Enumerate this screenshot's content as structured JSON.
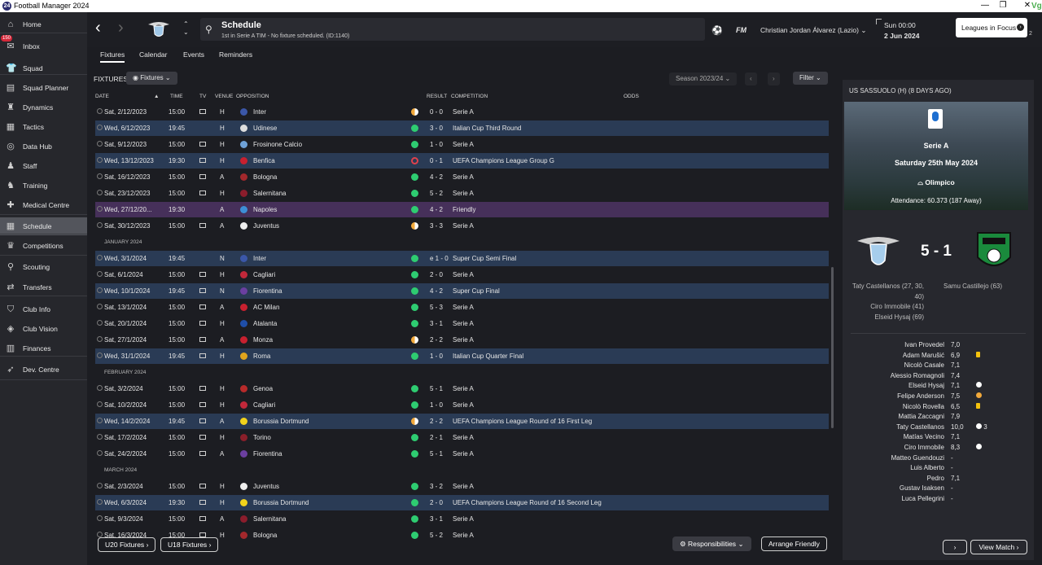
{
  "window": {
    "title": "Football Manager 2024",
    "app_icon": "24",
    "controls": [
      "—",
      "❐",
      "✕"
    ]
  },
  "sidebar": {
    "items": [
      {
        "label": "Home",
        "icon": "home-icon"
      },
      {
        "label": "Inbox",
        "icon": "inbox-icon",
        "badge": "150"
      },
      {
        "label": "Squad",
        "icon": "shirt-icon"
      },
      {
        "label": "Squad Planner",
        "icon": "planner-icon"
      },
      {
        "label": "Dynamics",
        "icon": "dynamics-icon"
      },
      {
        "label": "Tactics",
        "icon": "tactics-icon"
      },
      {
        "label": "Data Hub",
        "icon": "data-hub-icon"
      },
      {
        "label": "Staff",
        "icon": "staff-icon"
      },
      {
        "label": "Training",
        "icon": "training-icon"
      },
      {
        "label": "Medical Centre",
        "icon": "medical-icon"
      },
      {
        "label": "Schedule",
        "icon": "calendar-icon"
      },
      {
        "label": "Competitions",
        "icon": "trophy-icon"
      },
      {
        "label": "Scouting",
        "icon": "scouting-icon"
      },
      {
        "label": "Transfers",
        "icon": "transfers-icon"
      },
      {
        "label": "Club Info",
        "icon": "shield-icon"
      },
      {
        "label": "Club Vision",
        "icon": "vision-icon"
      },
      {
        "label": "Finances",
        "icon": "finances-icon"
      },
      {
        "label": "Dev. Centre",
        "icon": "dev-centre-icon"
      }
    ]
  },
  "topbar": {
    "title": "Schedule",
    "subtitle": "1st in Serie A TIM - No fixture scheduled. (ID:1140)",
    "fm_logo": "FM",
    "manager": "Christian Jordan Álvarez (Lazio)",
    "day_time": "Sun 00:00",
    "date": "2 Jun 2024",
    "focus_button": "Leagues in Focus",
    "focus_count": "2"
  },
  "tabs": [
    "Fixtures",
    "Calendar",
    "Events",
    "Reminders"
  ],
  "fixtures": {
    "header": "FIXTURES",
    "view_dropdown": "Fixtures",
    "season": "Season 2023/24",
    "filter": "Filter",
    "columns": {
      "date": "DATE",
      "time": "TIME",
      "tv": "TV",
      "venue": "VENUE",
      "opposition": "OPPOSITION",
      "result": "RESULT",
      "competition": "COMPETITION",
      "odds": "ODDS"
    },
    "rows": [
      {
        "date": "Sat, 2/12/2023",
        "time": "15:00",
        "tv": true,
        "venue": "H",
        "opp": "Inter",
        "result": "0 - 0",
        "comp": "Serie A",
        "outcome": "draw",
        "kind": "league",
        "crest": "#3b57a8"
      },
      {
        "date": "Wed, 6/12/2023",
        "time": "19:45",
        "tv": false,
        "venue": "H",
        "opp": "Udinese",
        "result": "3 - 0",
        "comp": "Italian Cup Third Round",
        "outcome": "win",
        "kind": "cup",
        "crest": "#dddddd"
      },
      {
        "date": "Sat, 9/12/2023",
        "time": "15:00",
        "tv": true,
        "venue": "H",
        "opp": "Frosinone Calcio",
        "result": "1 - 0",
        "comp": "Serie A",
        "outcome": "win",
        "kind": "league",
        "crest": "#6fa2d8"
      },
      {
        "date": "Wed, 13/12/2023",
        "time": "19:30",
        "tv": true,
        "venue": "H",
        "opp": "Benfica",
        "result": "0 - 1",
        "comp": "UEFA Champions League Group G",
        "outcome": "loss",
        "kind": "cup",
        "crest": "#c8202f"
      },
      {
        "date": "Sat, 16/12/2023",
        "time": "15:00",
        "tv": true,
        "venue": "A",
        "opp": "Bologna",
        "result": "4 - 2",
        "comp": "Serie A",
        "outcome": "win",
        "kind": "league",
        "crest": "#a3282c"
      },
      {
        "date": "Sat, 23/12/2023",
        "time": "15:00",
        "tv": true,
        "venue": "H",
        "opp": "Salernitana",
        "result": "5 - 2",
        "comp": "Serie A",
        "outcome": "win",
        "kind": "league",
        "crest": "#8b1d2c"
      },
      {
        "date": "Wed, 27/12/20...",
        "time": "19:30",
        "tv": false,
        "venue": "A",
        "opp": "Napoles",
        "result": "4 - 2",
        "comp": "Friendly",
        "outcome": "win",
        "kind": "friendly",
        "crest": "#3d8fd6"
      },
      {
        "date": "Sat, 30/12/2023",
        "time": "15:00",
        "tv": true,
        "venue": "A",
        "opp": "Juventus",
        "result": "3 - 3",
        "comp": "Serie A",
        "outcome": "draw",
        "kind": "league",
        "crest": "#eeeeee"
      },
      {
        "month": "JANUARY 2024"
      },
      {
        "date": "Wed, 3/1/2024",
        "time": "19:45",
        "tv": false,
        "venue": "N",
        "opp": "Inter",
        "result": "e 1 - 0",
        "comp": "Super Cup Semi Final",
        "outcome": "win",
        "kind": "cup",
        "crest": "#3b57a8"
      },
      {
        "date": "Sat, 6/1/2024",
        "time": "15:00",
        "tv": true,
        "venue": "H",
        "opp": "Cagliari",
        "result": "2 - 0",
        "comp": "Serie A",
        "outcome": "win",
        "kind": "league",
        "crest": "#c1283a"
      },
      {
        "date": "Wed, 10/1/2024",
        "time": "19:45",
        "tv": true,
        "venue": "N",
        "opp": "Fiorentina",
        "result": "4 - 2",
        "comp": "Super Cup Final",
        "outcome": "win",
        "kind": "cup",
        "crest": "#6b3fa0"
      },
      {
        "date": "Sat, 13/1/2024",
        "time": "15:00",
        "tv": true,
        "venue": "A",
        "opp": "AC Milan",
        "result": "5 - 3",
        "comp": "Serie A",
        "outcome": "win",
        "kind": "league",
        "crest": "#c8202f"
      },
      {
        "date": "Sat, 20/1/2024",
        "time": "15:00",
        "tv": true,
        "venue": "H",
        "opp": "Atalanta",
        "result": "3 - 1",
        "comp": "Serie A",
        "outcome": "win",
        "kind": "league",
        "crest": "#1f4ea8"
      },
      {
        "date": "Sat, 27/1/2024",
        "time": "15:00",
        "tv": true,
        "venue": "A",
        "opp": "Monza",
        "result": "2 - 2",
        "comp": "Serie A",
        "outcome": "draw",
        "kind": "league",
        "crest": "#c8202f"
      },
      {
        "date": "Wed, 31/1/2024",
        "time": "19:45",
        "tv": true,
        "venue": "H",
        "opp": "Roma",
        "result": "1 - 0",
        "comp": "Italian Cup Quarter Final",
        "outcome": "win",
        "kind": "cup",
        "crest": "#e0a41d"
      },
      {
        "month": "FEBRUARY 2024"
      },
      {
        "date": "Sat, 3/2/2024",
        "time": "15:00",
        "tv": true,
        "venue": "H",
        "opp": "Genoa",
        "result": "5 - 1",
        "comp": "Serie A",
        "outcome": "win",
        "kind": "league",
        "crest": "#b72a2a"
      },
      {
        "date": "Sat, 10/2/2024",
        "time": "15:00",
        "tv": true,
        "venue": "H",
        "opp": "Cagliari",
        "result": "1 - 0",
        "comp": "Serie A",
        "outcome": "win",
        "kind": "league",
        "crest": "#c1283a"
      },
      {
        "date": "Wed, 14/2/2024",
        "time": "19:45",
        "tv": true,
        "venue": "A",
        "opp": "Borussia Dortmund",
        "result": "2 - 2",
        "comp": "UEFA Champions League Round of 16  First Leg",
        "outcome": "draw",
        "kind": "cup",
        "crest": "#f2d21b"
      },
      {
        "date": "Sat, 17/2/2024",
        "time": "15:00",
        "tv": true,
        "venue": "H",
        "opp": "Torino",
        "result": "2 - 1",
        "comp": "Serie A",
        "outcome": "win",
        "kind": "league",
        "crest": "#8a1f2a"
      },
      {
        "date": "Sat, 24/2/2024",
        "time": "15:00",
        "tv": true,
        "venue": "A",
        "opp": "Fiorentina",
        "result": "5 - 1",
        "comp": "Serie A",
        "outcome": "win",
        "kind": "league",
        "crest": "#6b3fa0"
      },
      {
        "month": "MARCH 2024"
      },
      {
        "date": "Sat, 2/3/2024",
        "time": "15:00",
        "tv": true,
        "venue": "H",
        "opp": "Juventus",
        "result": "3 - 2",
        "comp": "Serie A",
        "outcome": "win",
        "kind": "league",
        "crest": "#eeeeee"
      },
      {
        "date": "Wed, 6/3/2024",
        "time": "19:30",
        "tv": true,
        "venue": "H",
        "opp": "Borussia Dortmund",
        "result": "2 - 0",
        "comp": "UEFA Champions League Round of 16  Second Leg",
        "outcome": "win",
        "kind": "cup",
        "crest": "#f2d21b"
      },
      {
        "date": "Sat, 9/3/2024",
        "time": "15:00",
        "tv": true,
        "venue": "A",
        "opp": "Salernitana",
        "result": "3 - 1",
        "comp": "Serie A",
        "outcome": "win",
        "kind": "league",
        "crest": "#8b1d2c"
      },
      {
        "date": "Sat, 16/3/2024",
        "time": "15:00",
        "tv": true,
        "venue": "H",
        "opp": "Bologna",
        "result": "5 - 2",
        "comp": "Serie A",
        "outcome": "win",
        "kind": "league",
        "crest": "#a3282c"
      }
    ]
  },
  "bottom_buttons": {
    "u20": "U20 Fixtures",
    "u18": "U18 Fixtures",
    "responsibilities": "Responsibilities",
    "arrange": "Arrange Friendly"
  },
  "match_panel": {
    "title": "US SASSUOLO (H) (8 DAYS AGO)",
    "competition": "Serie A",
    "date": "Saturday 25th May 2024",
    "stadium": "Olimpico",
    "attendance": "Attendance: 60.373 (187 Away)",
    "score": "5 - 1",
    "home_scorers": [
      "Taty Castellanos (27, 30,",
      "40)",
      "Ciro Immobile (41)",
      "Elseid Hysaj (69)"
    ],
    "away_scorers": [
      "Samu Castillejo (63)"
    ],
    "players": [
      {
        "name": "Ivan Provedel",
        "rating": "7,0",
        "icon": ""
      },
      {
        "name": "Adam Marušić",
        "rating": "6,9",
        "icon": "yellow-card"
      },
      {
        "name": "Nicolò Casale",
        "rating": "7,1",
        "icon": ""
      },
      {
        "name": "Alessio Romagnoli",
        "rating": "7,4",
        "icon": ""
      },
      {
        "name": "Elseid Hysaj",
        "rating": "7,1",
        "icon": "goal"
      },
      {
        "name": "Felipe Anderson",
        "rating": "7,5",
        "icon": "assist"
      },
      {
        "name": "Nicolò Rovella",
        "rating": "6,5",
        "icon": "yellow-card"
      },
      {
        "name": "Mattia Zaccagni",
        "rating": "7,9",
        "icon": ""
      },
      {
        "name": "Taty Castellanos",
        "rating": "10,0",
        "icon": "goal",
        "count": "3"
      },
      {
        "name": "Matías Vecino",
        "rating": "7,1",
        "icon": ""
      },
      {
        "name": "Ciro Immobile",
        "rating": "8,3",
        "icon": "goal"
      },
      {
        "name": "Matteo Guendouzi",
        "rating": "-",
        "icon": ""
      },
      {
        "name": "Luis Alberto",
        "rating": "-",
        "icon": ""
      },
      {
        "name": "Pedro",
        "rating": "7,1",
        "icon": ""
      },
      {
        "name": "Gustav Isaksen",
        "rating": "-",
        "icon": ""
      },
      {
        "name": "Luca Pellegrini",
        "rating": "-",
        "icon": ""
      }
    ],
    "view_match": "View Match"
  },
  "colors": {
    "win": "#2ecc71",
    "draw": "#f2a93b",
    "loss": "#e0414c",
    "cup_row": "#2a3b55",
    "friendly_row": "#46305a",
    "accent": "#49a0e0"
  }
}
